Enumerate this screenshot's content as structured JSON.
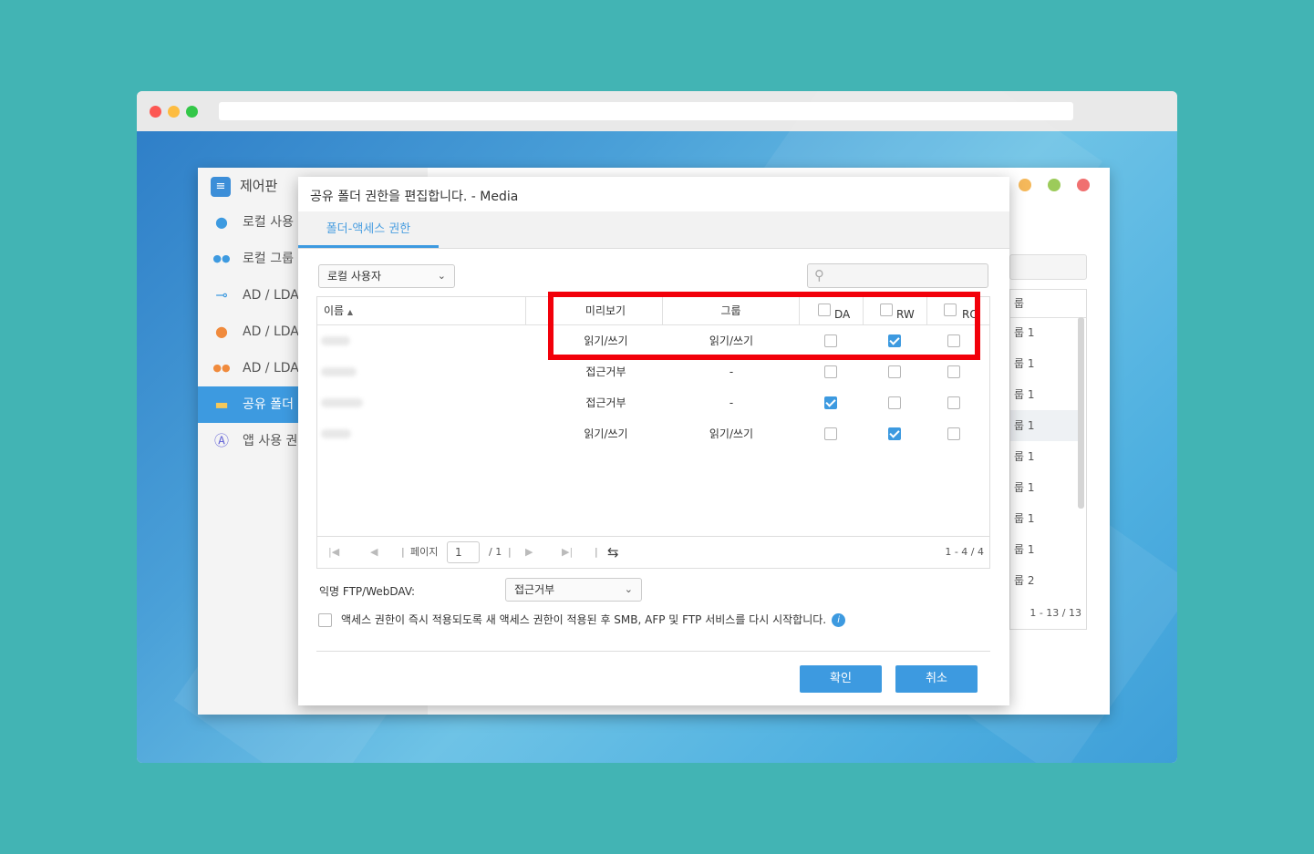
{
  "colors": {
    "background": "#42b4b4",
    "accent": "#3d9ae0",
    "highlight": "#f2000a"
  },
  "control_panel": {
    "title": "제어판",
    "sidebar": [
      {
        "label": "로컬 사용",
        "icon": "user-icon",
        "color": "#3d9ae0"
      },
      {
        "label": "로컬 그룹",
        "icon": "group-icon",
        "color": "#3d9ae0"
      },
      {
        "label": "AD / LDAF",
        "icon": "key-icon",
        "color": "#3d9ae0"
      },
      {
        "label": "AD / LDAF",
        "icon": "user-icon",
        "color": "#f08a3c"
      },
      {
        "label": "AD / LDAF",
        "icon": "group-icon",
        "color": "#f08a3c"
      },
      {
        "label": "공유 폴더",
        "icon": "folder-icon",
        "color": "#f5c85a"
      },
      {
        "label": "앱 사용 권",
        "icon": "app-icon",
        "color": "#6a6ad8"
      }
    ],
    "right_header": "룹",
    "right_rows": [
      "룹 1",
      "룹 1",
      "룹 1",
      "룹 1",
      "룹 1",
      "룹 1",
      "룹 1",
      "룹 1",
      "룹 2"
    ],
    "right_footer": "1 - 13 / 13"
  },
  "dialog": {
    "title": "공유 폴더 권한을 편집합니다. - Media",
    "tab": "폴더-액세스 권한",
    "user_type": "로컬 사용자",
    "search_placeholder": "",
    "columns": {
      "name": "이름",
      "preview": "미리보기",
      "group": "그룹",
      "da": "DA",
      "rw": "RW",
      "ro": "RO"
    },
    "rows": [
      {
        "preview": "읽기/쓰기",
        "group": "읽기/쓰기",
        "da": false,
        "rw": true,
        "ro": false
      },
      {
        "preview": "접근거부",
        "group": "-",
        "da": false,
        "rw": false,
        "ro": false
      },
      {
        "preview": "접근거부",
        "group": "-",
        "da": true,
        "rw": false,
        "ro": false
      },
      {
        "preview": "읽기/쓰기",
        "group": "읽기/쓰기",
        "da": false,
        "rw": true,
        "ro": false
      }
    ],
    "pager": {
      "page_label": "페이지",
      "page": "1",
      "total": "/ 1",
      "range": "1 - 4 / 4"
    },
    "anon_label": "익명 FTP/WebDAV:",
    "anon_value": "접근거부",
    "restart_text": "액세스 권한이 즉시 적용되도록 새 액세스 권한이 적용된 후 SMB, AFP 및 FTP 서비스를 다시 시작합니다.",
    "ok": "확인",
    "cancel": "취소"
  }
}
